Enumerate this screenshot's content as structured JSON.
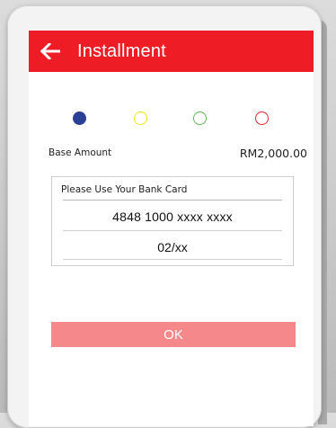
{
  "header": {
    "title": "Installment",
    "back_icon": "arrow-left-icon",
    "color": "#ee1c25"
  },
  "steps": [
    {
      "color": "#2b3f96",
      "filled": true
    },
    {
      "color": "#f2e51c",
      "filled": false
    },
    {
      "color": "#5cb84a",
      "filled": false
    },
    {
      "color": "#e5222a",
      "filled": false
    }
  ],
  "amount": {
    "label": "Base Amount",
    "value": "RM2,000.00"
  },
  "card": {
    "hint": "Please Use Your Bank Card",
    "number": "4848 1000 xxxx xxxx",
    "expiry": "02/xx"
  },
  "actions": {
    "ok_label": "OK",
    "ok_color": "#f5888b"
  }
}
